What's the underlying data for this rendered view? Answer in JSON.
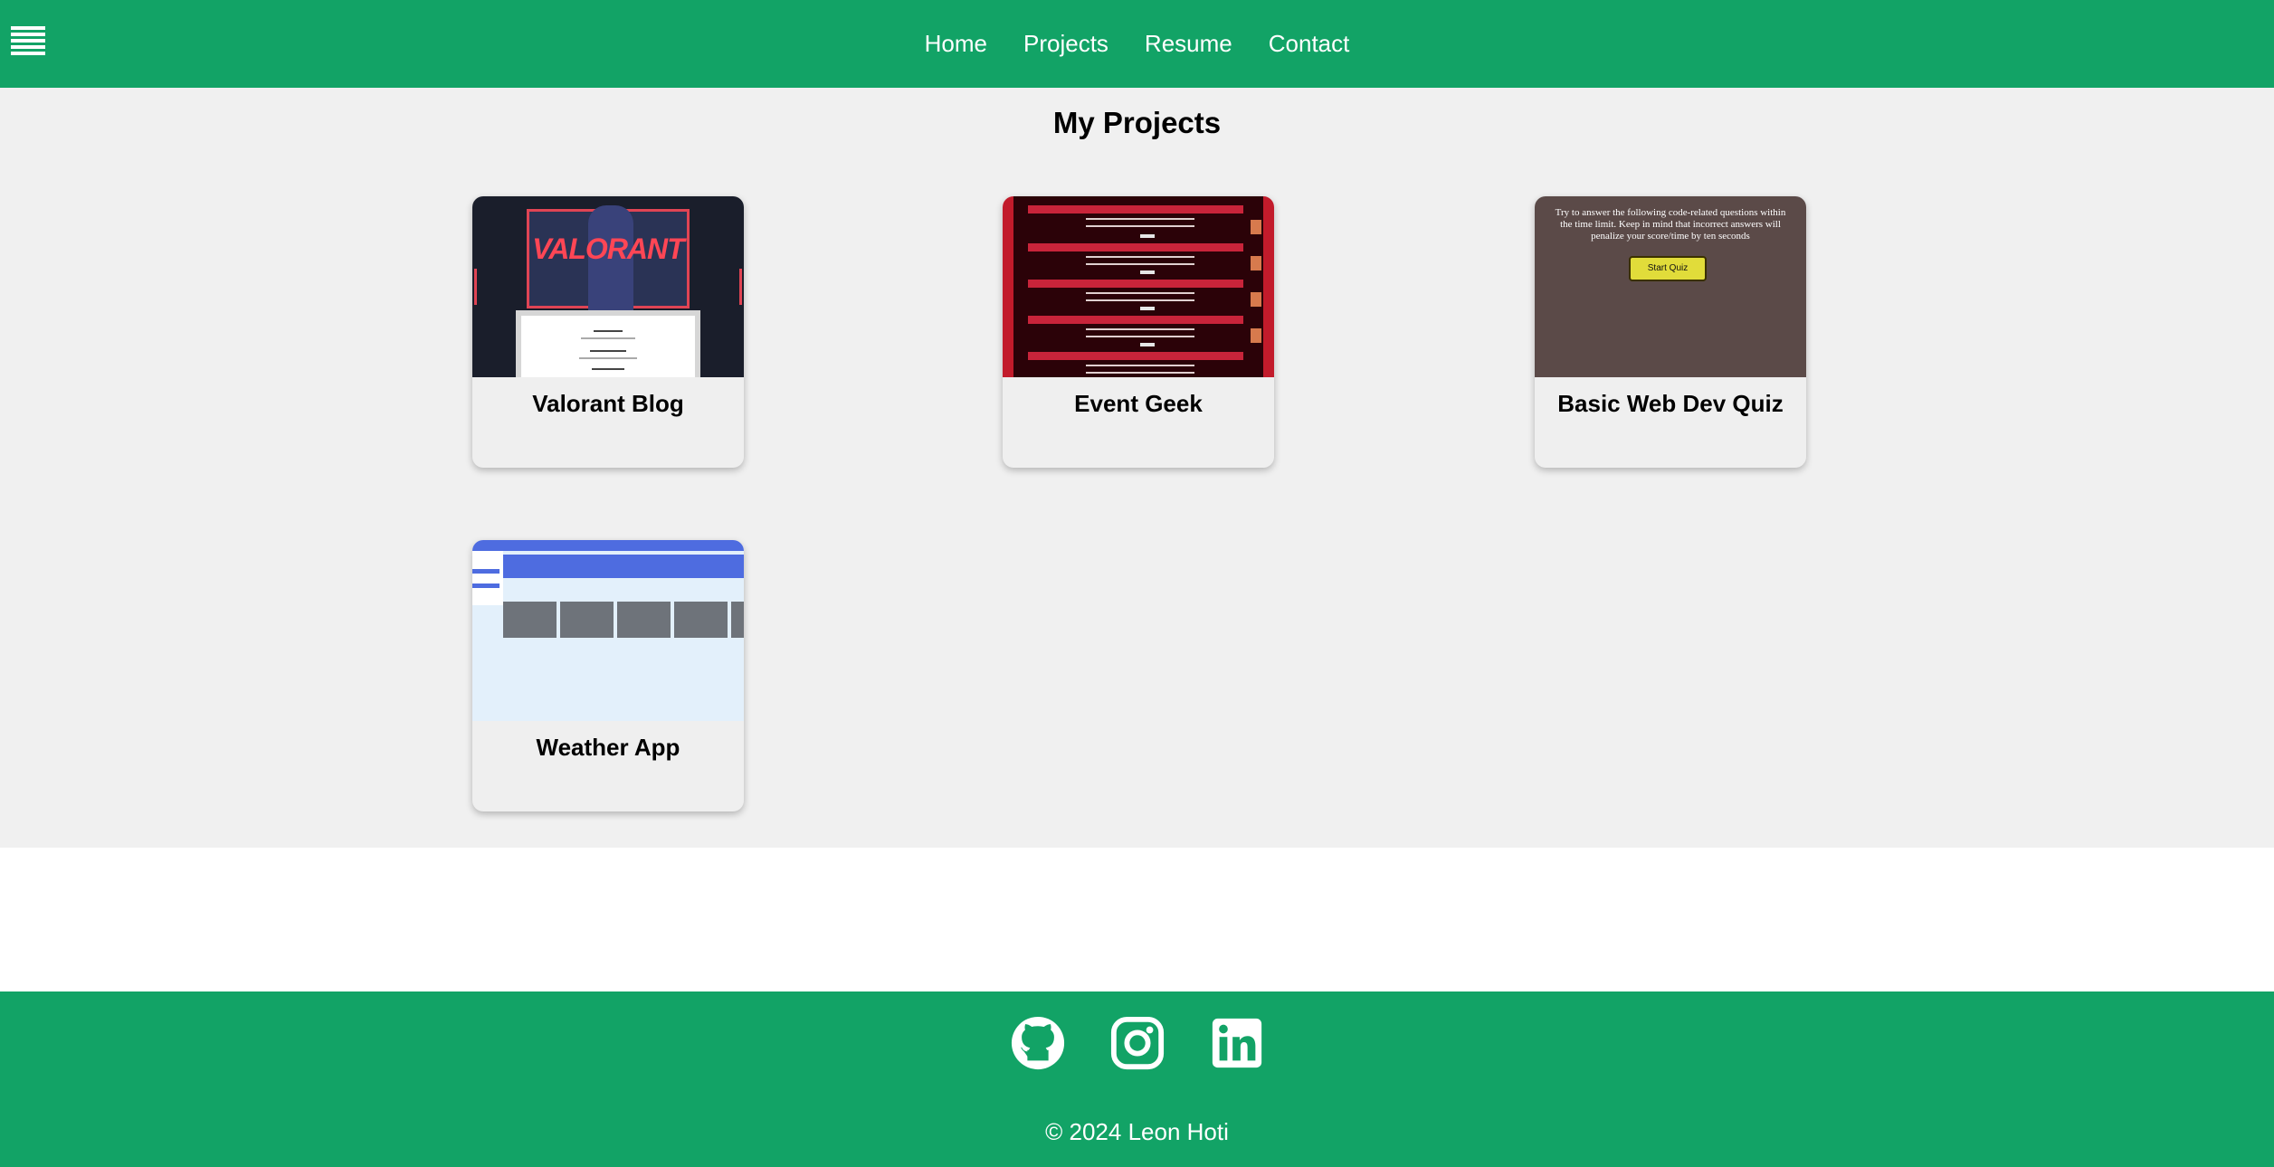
{
  "nav": {
    "menu_icon": "hamburger-icon",
    "links": [
      "Home",
      "Projects",
      "Resume",
      "Contact"
    ]
  },
  "main": {
    "title": "My Projects",
    "projects": [
      {
        "title": "Valorant Blog",
        "thumbnail_logo": "VALORANT"
      },
      {
        "title": "Event Geek"
      },
      {
        "title": "Basic Web Dev Quiz",
        "thumbnail_text": "Try to answer the following code-related questions within the time limit. Keep in mind that incorrect answers will penalize your score/time by ten seconds",
        "thumbnail_button": "Start Quiz"
      },
      {
        "title": "Weather App"
      }
    ]
  },
  "footer": {
    "social_icons": [
      "github-icon",
      "instagram-icon",
      "linkedin-icon"
    ],
    "copyright": "© 2024 Leon Hoti"
  },
  "colors": {
    "brand_green": "#12a366",
    "page_bg": "#f0f0f0"
  }
}
